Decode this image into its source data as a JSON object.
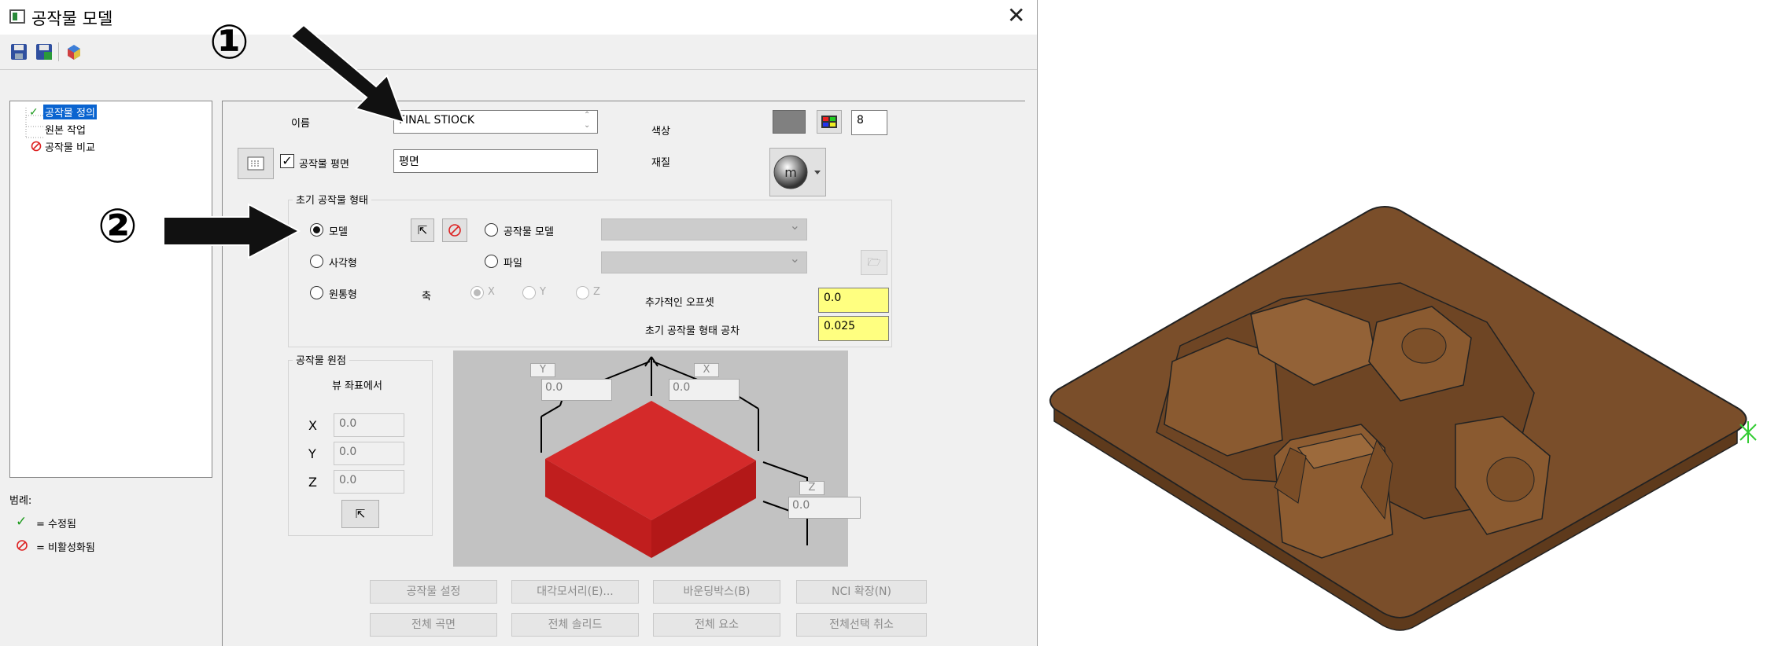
{
  "window": {
    "title": "공작물 모델",
    "close": "✕"
  },
  "toolbar": {
    "save": "save-icon",
    "save_as": "save-as-icon",
    "model": "model-icon"
  },
  "tree": {
    "items": [
      "공작물 정의",
      "원본 작업",
      "공작물 비교"
    ]
  },
  "legend": {
    "title": "범례:",
    "modified": "= 수정됨",
    "disabled": "= 비활성화됨"
  },
  "name_label": "이름",
  "name_value": "FINAL STIOCK",
  "color_label": "색상",
  "color_value": "8",
  "color_swatch": "#808080",
  "material_label": "재질",
  "stock_plane": {
    "label": "공작물 평면",
    "checked": true,
    "value": "평면"
  },
  "initial_shape": {
    "title": "초기 공작물 형태",
    "model": "모델",
    "rectangle": "사각형",
    "cylinder": "원통형",
    "stock_model": "공작물 모델",
    "file": "파일",
    "axis": "축",
    "x": "X",
    "y": "Y",
    "z": "Z",
    "extra_offset_label": "추가적인 오프셋",
    "extra_offset_value": "0.0",
    "tolerance_label": "초기 공작물 형태 공차",
    "tolerance_value": "0.025"
  },
  "origin": {
    "title": "공작물 원점",
    "view": "뷰 좌표에서",
    "x_label": "X",
    "x_value": "0.0",
    "y_label": "Y",
    "y_value": "0.0",
    "z_label": "Z",
    "z_value": "0.0"
  },
  "preview": {
    "y_tag": "Y",
    "y_value": "0.0",
    "x_tag": "X",
    "x_value": "0.0",
    "z_tag": "Z",
    "z_value": "0.0",
    "stock_color": "#cc2222"
  },
  "buttons": {
    "stock_setup": "공작물 설정",
    "diagonal": "대각모서리(E)...",
    "bounding_box": "바운딩박스(B)",
    "nci_extents": "NCI 확장(N)",
    "all_surfaces": "전체 곡면",
    "all_solids": "전체 솔리드",
    "all_entities": "전체 요소",
    "select_all_cancel": "전체선택 취소"
  },
  "annotations": {
    "one": "①",
    "two": "②"
  },
  "part_color": "#7a4e2a"
}
